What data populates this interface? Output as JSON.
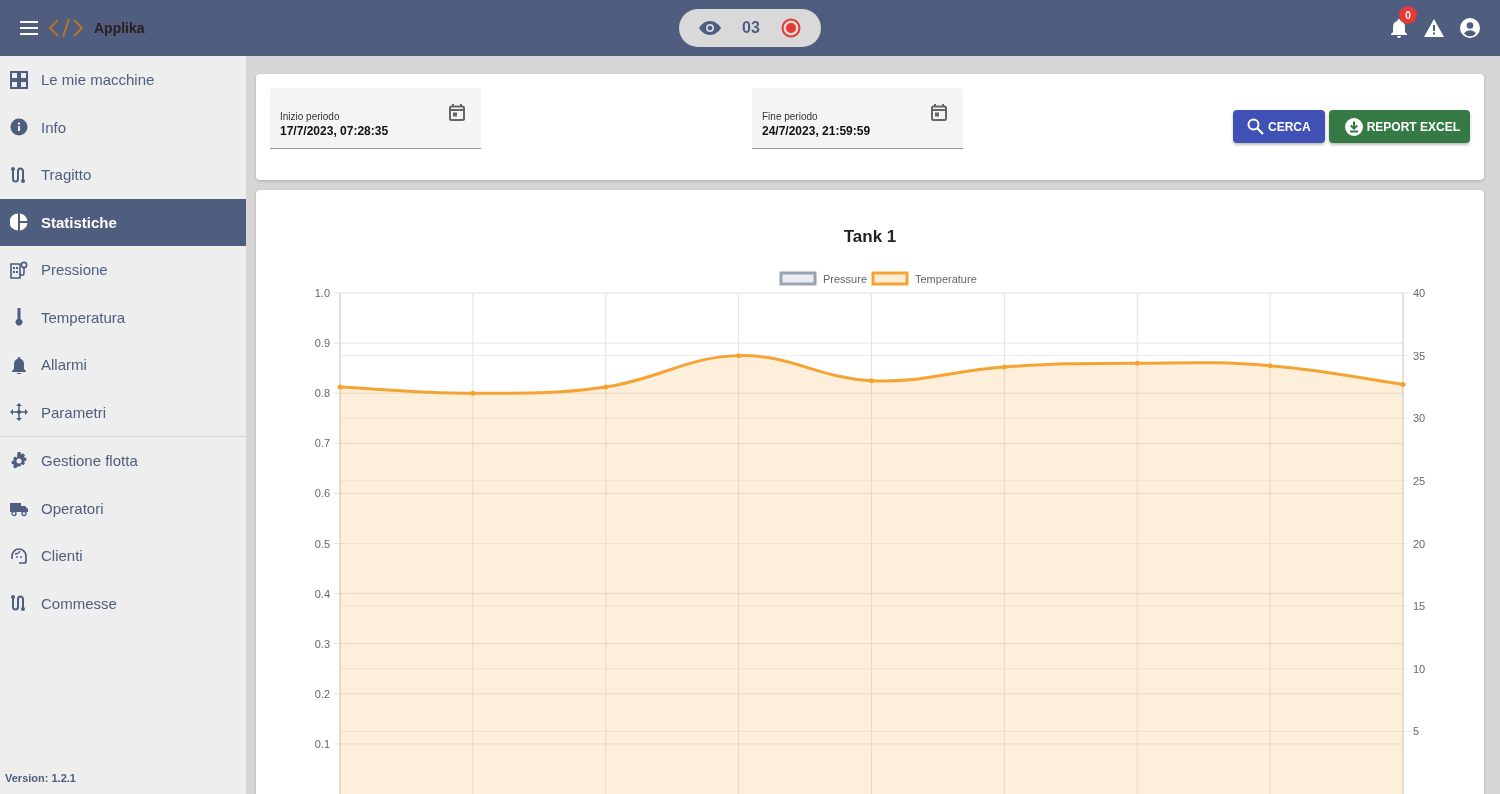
{
  "header": {
    "brand": "Applika",
    "counter": "03",
    "notifications_badge": "0"
  },
  "sidebar": {
    "groups": [
      {
        "items": [
          {
            "label": "Le mie macchine",
            "selected": false
          },
          {
            "label": "Info",
            "selected": false
          },
          {
            "label": "Tragitto",
            "selected": false
          },
          {
            "label": "Statistiche",
            "selected": true
          },
          {
            "label": "Pressione",
            "selected": false
          },
          {
            "label": "Temperatura",
            "selected": false
          },
          {
            "label": "Allarmi",
            "selected": false
          },
          {
            "label": "Parametri",
            "selected": false
          }
        ]
      },
      {
        "items": [
          {
            "label": "Gestione flotta",
            "selected": false
          },
          {
            "label": "Operatori",
            "selected": false
          },
          {
            "label": "Clienti",
            "selected": false
          },
          {
            "label": "Commesse",
            "selected": false
          }
        ]
      }
    ],
    "version": "Version: 1.2.1"
  },
  "filters": {
    "start": {
      "label": "Inizio periodo",
      "value": "17/7/2023, 07:28:35"
    },
    "end": {
      "label": "Fine periodo",
      "value": "24/7/2023, 21:59:59"
    },
    "buttons": [
      {
        "label": "CERCA",
        "kind": "search"
      },
      {
        "label": "REPORT EXCEL",
        "kind": "download"
      }
    ]
  },
  "chart": {
    "chart_data": {
      "type": "area",
      "title": "Tank 1",
      "series": [
        {
          "name": "Pressure",
          "color": "#9aa3b5",
          "values": [
            null,
            null,
            null,
            null,
            null,
            null,
            null,
            null,
            null
          ]
        },
        {
          "name": "Temperature",
          "color": "#f5a433",
          "values": [
            32.5,
            32,
            32.5,
            35,
            33,
            34.1,
            34.4,
            34.2,
            32.7
          ]
        }
      ],
      "ylim": [
        0,
        40
      ],
      "yticks": [
        5,
        10,
        15,
        20,
        25,
        30,
        35,
        40
      ],
      "grid": true
    },
    "left_axis_labels": [
      "1.0",
      "0.9",
      "0.8",
      "0.7",
      "0.6",
      "0.5",
      "0.4",
      "0.3",
      "0.2",
      "0.1"
    ]
  }
}
